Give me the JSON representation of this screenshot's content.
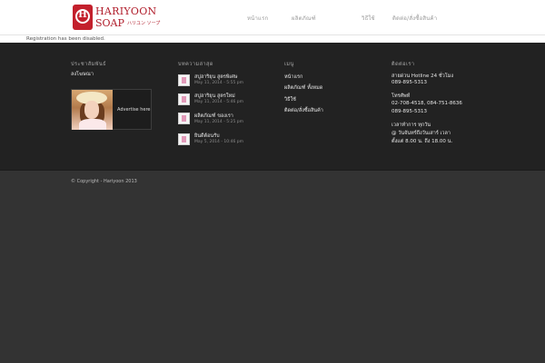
{
  "header": {
    "logo": {
      "line1": "HARIYOON",
      "line2": "SOAP",
      "sub": "ハリユン ソープ",
      "badge_letter": "H"
    },
    "nav": [
      {
        "label": "หน้าแรก",
        "active": false
      },
      {
        "label": "ผลิตภัณฑ์",
        "active": false
      },
      {
        "label": "วิธีใช้",
        "active": false
      },
      {
        "label": "ติดต่อ/สั่งซื้อสินค้า",
        "active": false
      }
    ]
  },
  "notice": "Registration has been disabled.",
  "footer": {
    "col1": {
      "title": "ประชาสัมพันธ์",
      "text": "ลงโฆษณา",
      "ad_label": "Advertise here"
    },
    "col2": {
      "title": "บทความล่าสุด",
      "posts": [
        {
          "title": "สบู่ฮาริยุน สูตรพิเศษ",
          "date": "May 11, 2014 - 5:55 pm"
        },
        {
          "title": "สบู่ฮาริยุน สูตรใหม่",
          "date": "May 11, 2014 - 5:46 pm"
        },
        {
          "title": "ผลิตภัณฑ์ ของเรา",
          "date": "May 11, 2014 - 5:25 pm"
        },
        {
          "title": "ยินดีต้อนรับ",
          "date": "May 5, 2014 - 10:46 pm"
        }
      ]
    },
    "col3": {
      "title": "เมนู",
      "links": [
        "หน้าแรก",
        "ผลิตภัณฑ์ ทั้งหมด",
        "วิธีใช้",
        "ติดต่อ/สั่งซื้อสินค้า"
      ]
    },
    "col4": {
      "title": "ติดต่อเรา",
      "hotline_label": "สายด่วน Hotline 24 ชั่วโมง",
      "hotline": "089-895-5313",
      "phone_label": "โทรศัพท์",
      "phones": "02-708-4518, 084-751-8636",
      "phone2": "089-895-5313",
      "hours_label": "เวลาทำการ ทุกวัน",
      "hours_line1": "@ วันจันทร์ถึงวันเสาร์ เวลา",
      "hours_line2": "ตั้งแต่ 8.00 น. ถึง 18.00 น."
    }
  },
  "copyright": "© Copyright - Hariyoon 2013",
  "colors": {
    "brand_red": "#c3202c",
    "footer_bg": "#222222",
    "page_bg": "#333333"
  }
}
